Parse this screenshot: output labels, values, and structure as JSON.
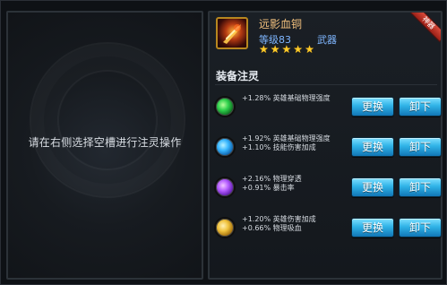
{
  "left_panel": {
    "hint": "请在右侧选择空槽进行注灵操作"
  },
  "item": {
    "name": "远影血铜",
    "level": "等级83",
    "type": "武器",
    "stars": 5,
    "badge": "神器"
  },
  "section": {
    "title": "装备注灵"
  },
  "slots": [
    {
      "gem": "green-swirl-gem-icon",
      "stats": [
        "+1.28% 英雄基础物理强度"
      ],
      "buttons": {
        "replace": "更换",
        "unload": "卸下"
      }
    },
    {
      "gem": "blue-swirl-gem-icon",
      "stats": [
        "+1.92% 英雄基础物理强度",
        "+1.10% 技能伤害加成"
      ],
      "buttons": {
        "replace": "更换",
        "unload": "卸下"
      }
    },
    {
      "gem": "purple-crystal-gem-icon",
      "stats": [
        "+2.16% 物理穿透",
        "+0.91% 暴击率"
      ],
      "buttons": {
        "replace": "更换",
        "unload": "卸下"
      }
    },
    {
      "gem": "gold-crest-gem-icon",
      "stats": [
        "+1.20% 英雄伤害加成",
        "+0.66% 物理吸血"
      ],
      "buttons": {
        "replace": "更换",
        "unload": "卸下"
      }
    }
  ]
}
